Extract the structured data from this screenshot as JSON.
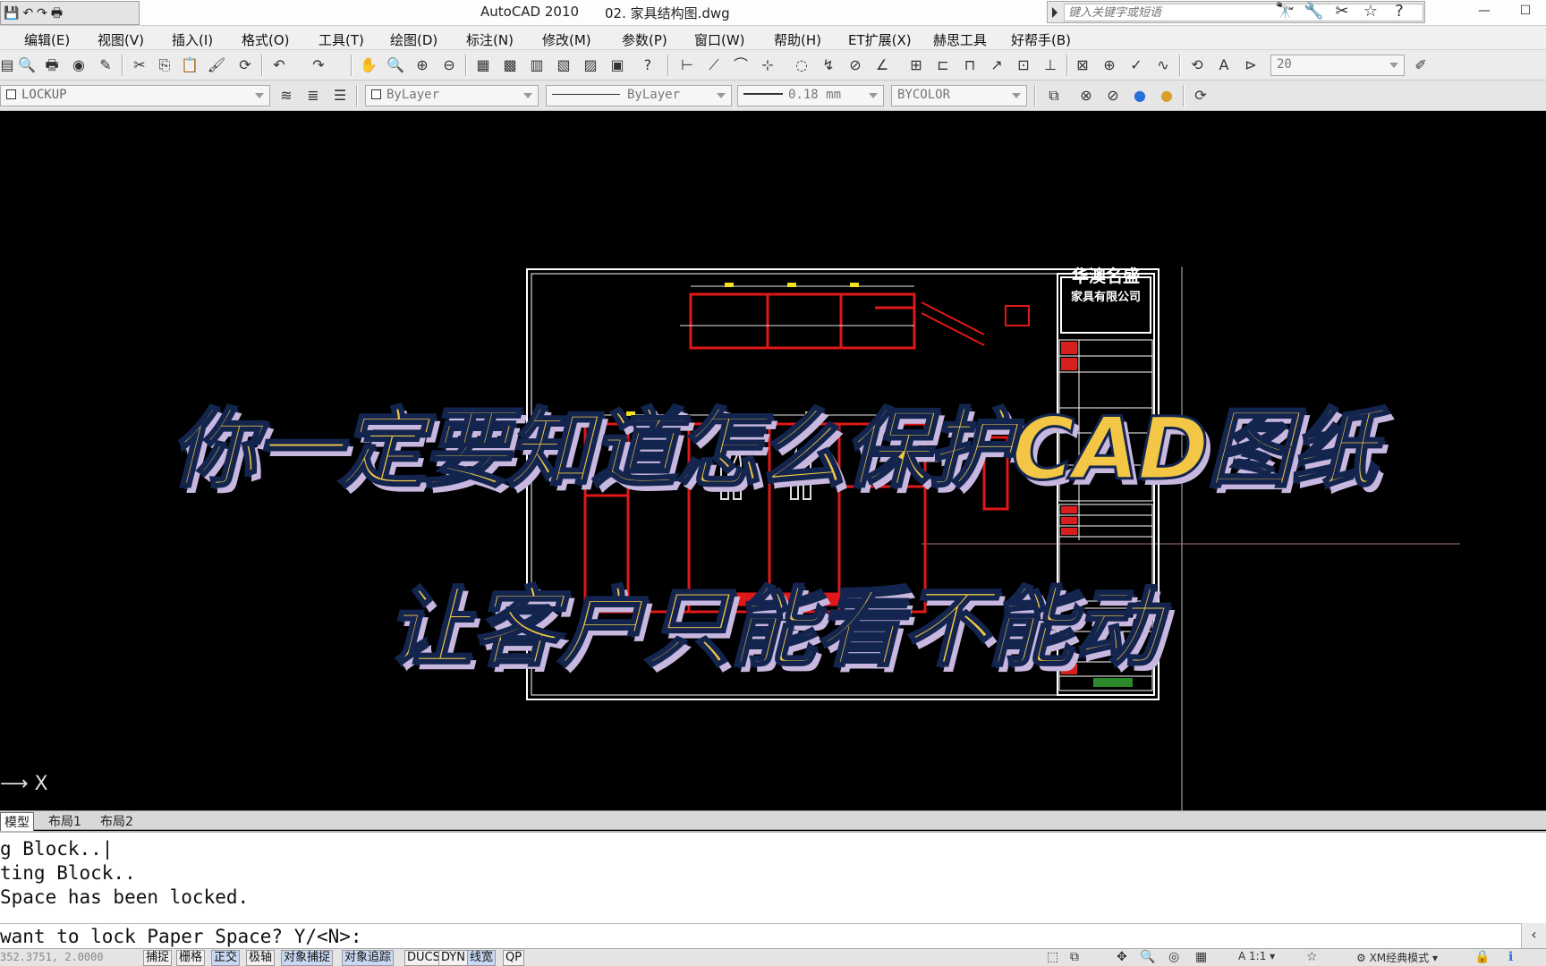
{
  "window": {
    "app_title": "AutoCAD 2010",
    "doc_title": "02. 家具结构图.dwg",
    "minimize": "—",
    "maximize": "☐"
  },
  "quick_access": {
    "icons": [
      "💾",
      "↶",
      "↷",
      "🖶"
    ]
  },
  "search": {
    "placeholder": "键入关键字或短语"
  },
  "title_icons": [
    "🔭",
    "🔧",
    "✂",
    "☆",
    "?"
  ],
  "menu": [
    "编辑(E)",
    "视图(V)",
    "插入(I)",
    "格式(O)",
    "工具(T)",
    "绘图(D)",
    "标注(N)",
    "修改(M)",
    "参数(P)",
    "窗口(W)",
    "帮助(H)",
    "ET扩展(X)",
    "赫思工具",
    "好帮手(B)"
  ],
  "toolbar2": {
    "layer": "LOCKUP",
    "color": "ByLayer",
    "linetype": "ByLayer",
    "lineweight": "0.18 mm",
    "plotstyle": "BYCOLOR",
    "text_height": "20"
  },
  "drawing": {
    "company_line1": "华澳名盛",
    "company_line2": "家具有限公司",
    "headline1": "你一定要知道怎么保护CAD图纸",
    "headline2": "让客户只能看不能动"
  },
  "tabs": [
    "模型",
    "布局1",
    "布局2"
  ],
  "command": {
    "lines": [
      "g Block..|",
      "ting Block..",
      "Space has been locked.",
      "want to lock Paper Space? Y/<N>:"
    ]
  },
  "status": {
    "coords": "352.3751, 2.0000",
    "buttons": [
      "捕捉",
      "栅格",
      "正交",
      "极轴",
      "对象捕捉",
      "对象追踪",
      "DUCS",
      "DYN",
      "线宽",
      "QP"
    ],
    "scale": "1:1",
    "workspace": "XM经典模式"
  }
}
